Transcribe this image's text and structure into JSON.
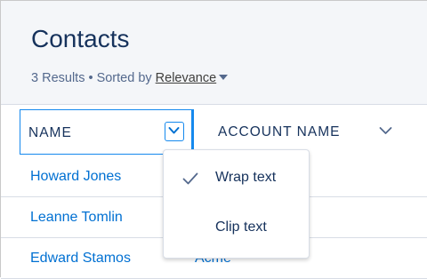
{
  "header": {
    "title": "Contacts",
    "result_summary": "3 Results • Sorted by",
    "sort_field": "Relevance"
  },
  "columns": {
    "name": {
      "label": "NAME"
    },
    "account": {
      "label": "ACCOUNT NAME"
    }
  },
  "rows": [
    {
      "name": "Howard Jones",
      "account": ""
    },
    {
      "name": "Leanne Tomlin",
      "account": ""
    },
    {
      "name": "Edward Stamos",
      "account": "Acme"
    }
  ],
  "column_menu": {
    "items": [
      {
        "label": "Wrap text",
        "selected": true
      },
      {
        "label": "Clip text",
        "selected": false
      }
    ]
  },
  "colors": {
    "link": "#0070d2",
    "focus_border": "#1589ee",
    "header_bg": "#f4f6f9",
    "text": "#16325c"
  },
  "icons": {
    "column_actions": "chevron-down-icon",
    "menu_selected": "check-icon"
  }
}
